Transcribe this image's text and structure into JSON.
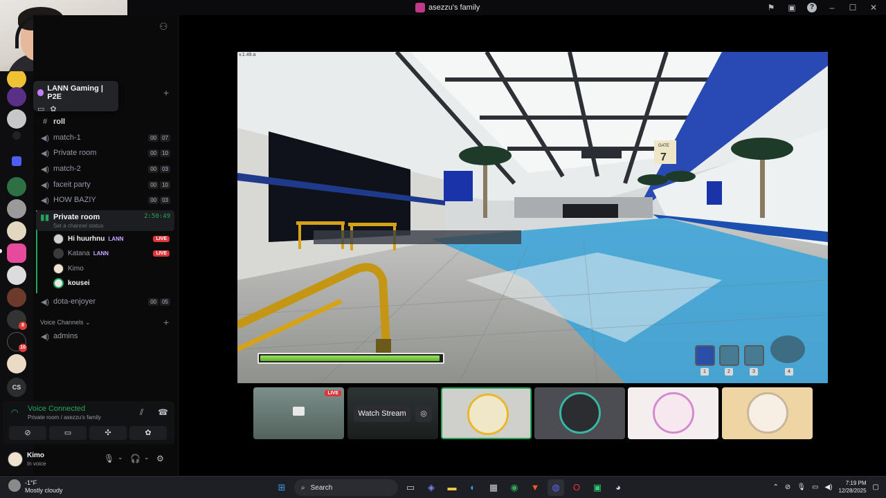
{
  "window": {
    "title": "asezzu's family"
  },
  "tooltip": {
    "server_name": "LANN Gaming | P2E"
  },
  "channels": [
    {
      "name": "roll",
      "type": "text"
    },
    {
      "name": "match-1",
      "count_a": "00",
      "count_b": "07"
    },
    {
      "name": "Private room",
      "count_a": "00",
      "count_b": "10"
    },
    {
      "name": "match-2",
      "count_a": "00",
      "count_b": "03"
    },
    {
      "name": "faceit party",
      "count_a": "00",
      "count_b": "10"
    },
    {
      "name": "HOW BAZIY",
      "count_a": "00",
      "count_b": "03"
    }
  ],
  "active_room": {
    "name": "Private room",
    "status": "Set a channel status",
    "timer": "2:50:49"
  },
  "members": [
    {
      "name": "Hi huurhnu",
      "tag": "LANN",
      "live": "LIVE"
    },
    {
      "name": "Katana",
      "tag": "LANN",
      "live": "LIVE"
    },
    {
      "name": "Kimo",
      "tag": "",
      "live": ""
    },
    {
      "name": "kousei",
      "tag": "",
      "live": ""
    }
  ],
  "after_channels": [
    {
      "name": "dota-enjoyer",
      "count_a": "00",
      "count_b": "05"
    }
  ],
  "category": {
    "name": "Voice Channels"
  },
  "voice_channels": [
    {
      "name": "admins"
    }
  ],
  "voice": {
    "status": "Voice Connected",
    "location": "Private room / asezzu's family"
  },
  "user": {
    "name": "Kimo",
    "status": "In voice"
  },
  "rail_badges": [
    "8",
    "10"
  ],
  "stream": {
    "version": "v.1.49.a",
    "health": 0.99,
    "slot_numbers": [
      "1",
      "2",
      "3",
      "4"
    ],
    "sign_gate": "GATE",
    "sign_number": "7"
  },
  "tiles": {
    "live_label": "LIVE",
    "watch_label": "Watch Stream"
  },
  "taskbar": {
    "temp": "-1°F",
    "weather": "Mostly cloudy",
    "search": "Search",
    "time": "7:19 PM",
    "date": "12/28/2025"
  },
  "colors": {
    "accent_green": "#23a55a",
    "live_red": "#da373c",
    "health_green": "#7ccf45"
  }
}
